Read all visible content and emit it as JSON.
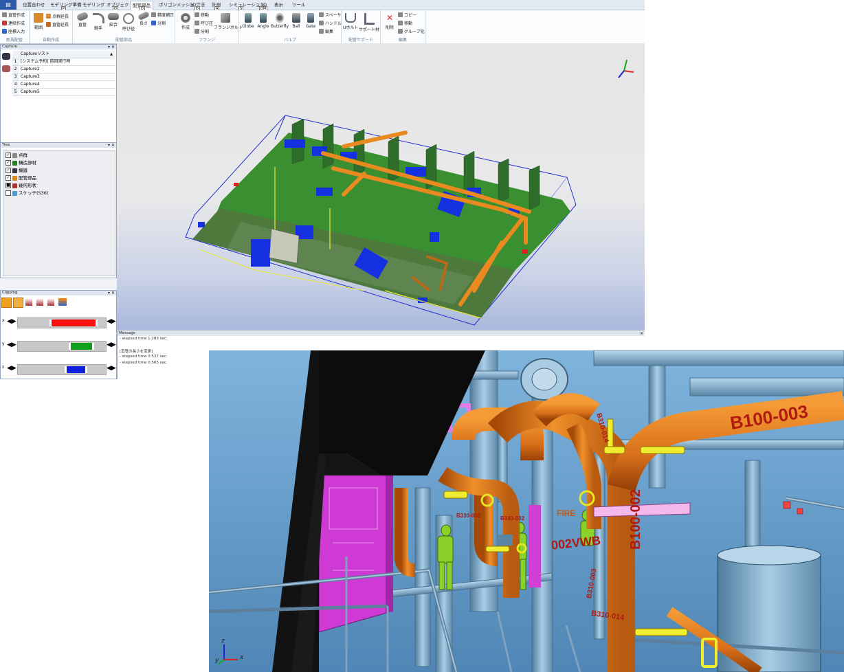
{
  "ribbon": {
    "file_label": "",
    "tabs": [
      {
        "label": "位置合わせ",
        "key": ""
      },
      {
        "label": "モデリング準備",
        "key": "P"
      },
      {
        "label": "モデリング",
        "key": ""
      },
      {
        "label": "オブジェクト",
        "key": "O"
      },
      {
        "label": "配管部品",
        "key": "D",
        "active": true
      },
      {
        "label": "ポリゴンメッシュ",
        "key": "D"
      },
      {
        "label": "3D寸法",
        "key": "P"
      },
      {
        "label": "計測",
        "key": "D"
      },
      {
        "label": "シミュレーション",
        "key": "A"
      },
      {
        "label": "3D",
        "key": "S"
      },
      {
        "label": "表示",
        "key": "DM"
      },
      {
        "label": "ツール",
        "key": ""
      }
    ],
    "groups": [
      {
        "label": "新規配管",
        "buttons": [
          "直管作成",
          "連続作成",
          "座標入力"
        ]
      },
      {
        "label": "自動作成",
        "buttons": [
          "範囲",
          "点群延長",
          "直管延長"
        ]
      },
      {
        "label": "配管部品",
        "buttons": [
          "直管",
          "継手",
          "結合",
          "呼び径",
          "長さ",
          "精度補正",
          "分割"
        ]
      },
      {
        "label": "フランジ",
        "buttons": [
          "作成",
          "移動",
          "呼び圧",
          "分割",
          "フランジボルト"
        ]
      },
      {
        "label": "バルブ",
        "buttons": [
          "Globe",
          "Angle",
          "Butterfly",
          "Ball",
          "Gate",
          "スペーサ",
          "ハンドル",
          "編集"
        ]
      },
      {
        "label": "配管サポート",
        "buttons": [
          "Uボルト",
          "サポート材"
        ]
      },
      {
        "label": "編集",
        "buttons": [
          "削除",
          "コピー",
          "移動",
          "グループ化"
        ]
      }
    ]
  },
  "capture_panel": {
    "title": "Capture",
    "header": "Captureリスト",
    "rows": [
      {
        "n": "1",
        "label": "[システム予約] 前回実行時"
      },
      {
        "n": "2",
        "label": "Capture2"
      },
      {
        "n": "3",
        "label": "Capture3"
      },
      {
        "n": "4",
        "label": "Capture4"
      },
      {
        "n": "5",
        "label": "Capture5"
      }
    ]
  },
  "tree_panel": {
    "title": "Tree",
    "items": [
      {
        "label": "点群"
      },
      {
        "label": "構造部材"
      },
      {
        "label": "機器"
      },
      {
        "label": "配管部品"
      },
      {
        "label": "幾何形状"
      },
      {
        "label": "スケッチ(S36)"
      }
    ]
  },
  "clipping_panel": {
    "title": "Clipping",
    "axes": [
      {
        "axis": "x",
        "color": "#ff1010",
        "range": [
          0.36,
          0.86
        ]
      },
      {
        "axis": "y",
        "color": "#10a020",
        "range": [
          0.58,
          0.82
        ]
      },
      {
        "axis": "z",
        "color": "#1020e0",
        "range": [
          0.53,
          0.74
        ]
      }
    ]
  },
  "message_panel": {
    "title": "Message",
    "lines": [
      "- elapsed time 1.283 sec.",
      "",
      "[直管の長さを変更]",
      "- elapsed time 0.537 sec.",
      "- elapsed time 0.565 sec."
    ]
  },
  "render_labels": {
    "b100_003": "B100-003",
    "b100_002": "B100-002",
    "vw_002": "002VWB",
    "b310_a": "B310-014",
    "b310_b": "B310-003",
    "b310_c": "B310-014",
    "b330": "B330-002",
    "b300": "B300-002",
    "fire": "FIRE",
    "axis_x": "x",
    "axis_y": "y",
    "axis_z": "z"
  },
  "colors": {
    "pipe_orange": "#e0781c",
    "pipe_blue": "#8fb6cf",
    "structure_green": "#2f8a2c",
    "equipment_blue": "#1430d8",
    "magenta": "#d436d8"
  }
}
